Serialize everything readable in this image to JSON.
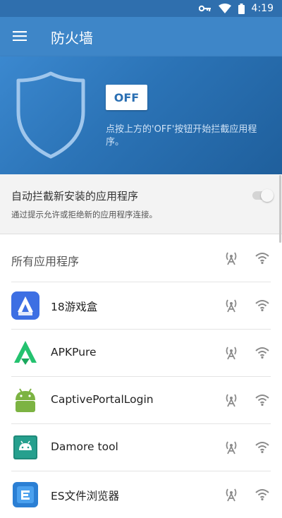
{
  "status_bar": {
    "time": "4:19"
  },
  "app_bar": {
    "title": "防火墙"
  },
  "hero": {
    "toggle_label": "OFF",
    "hint": "点按上方的'OFF'按钮开始拦截应用程序。"
  },
  "auto_block": {
    "title": "自动拦截新安装的应用程序",
    "description": "通过提示允许或拒绝新的应用程序连接。",
    "enabled": false
  },
  "list": {
    "header": "所有应用程序",
    "apps": [
      {
        "name": "18游戏盒",
        "icon": "game-box-app-icon"
      },
      {
        "name": "APKPure",
        "icon": "apkpure-app-icon"
      },
      {
        "name": "CaptivePortalLogin",
        "icon": "android-robot-icon"
      },
      {
        "name": "Damore tool",
        "icon": "android-teal-icon"
      },
      {
        "name": "ES文件浏览器",
        "icon": "es-file-explorer-icon"
      }
    ]
  },
  "colors": {
    "primary": "#3e86c8",
    "status_bar": "#2f6fae",
    "accent_off": "#2a6fb3"
  }
}
